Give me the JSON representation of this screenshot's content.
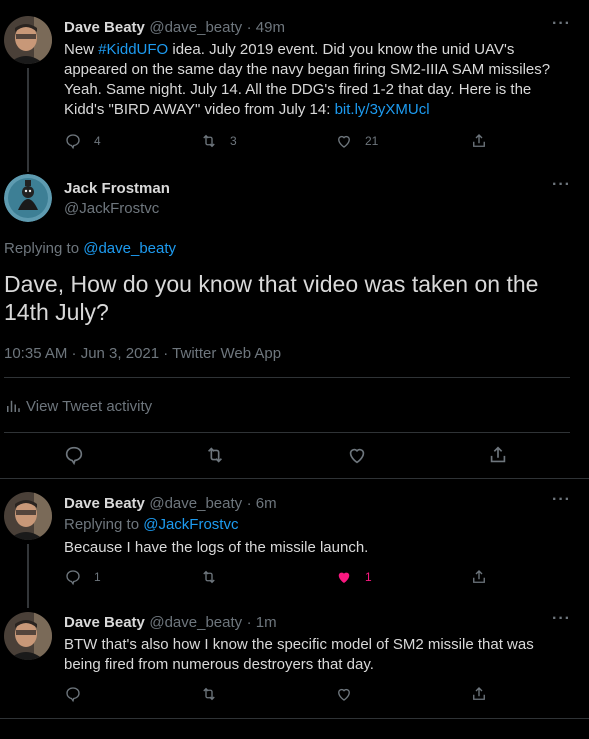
{
  "tweets": [
    {
      "name": "Dave Beaty",
      "handle": "@dave_beaty",
      "time": "· 49m",
      "text_before_tag": "New ",
      "hashtag": "#KiddUFO",
      "text_after_tag": " idea. July 2019 event. Did you know the unid UAV's appeared on the same day the navy began firing SM2-IIIA SAM missiles? Yeah. Same night.  July 14. All the DDG's fired 1-2 that day.  Here is the Kidd's \"BIRD AWAY\" video from July 14: ",
      "link": "bit.ly/3yXMUcl",
      "reply_count": "4",
      "retweet_count": "3",
      "like_count": "21"
    },
    {
      "name": "Dave Beaty",
      "handle": "@dave_beaty",
      "time": "· 6m",
      "replying_to_label": "Replying to ",
      "replying_to_handle": "@JackFrostvc",
      "text": "Because I have the logs of the missile launch.",
      "reply_count": "1",
      "retweet_count": "",
      "like_count": "1"
    },
    {
      "name": "Dave Beaty",
      "handle": "@dave_beaty",
      "time": "· 1m",
      "text": "BTW that's also how I know the specific model of SM2 missile that was being fired from numerous destroyers that day.",
      "reply_count": "",
      "retweet_count": "",
      "like_count": ""
    }
  ],
  "main_tweet": {
    "name": "Jack Frostman",
    "handle": "@JackFrostvc",
    "replying_to_label": "Replying to ",
    "replying_to_handle": "@dave_beaty",
    "text": "Dave,  How do you know that video was taken on  the 14th July?",
    "meta": "10:35 AM · Jun 3, 2021 · Twitter Web App",
    "activity_label": "View Tweet activity"
  },
  "more_label": "···",
  "colors": {
    "accent": "#1d9bf0",
    "like": "#f91880",
    "bg": "#000000",
    "muted": "#6e767d"
  }
}
